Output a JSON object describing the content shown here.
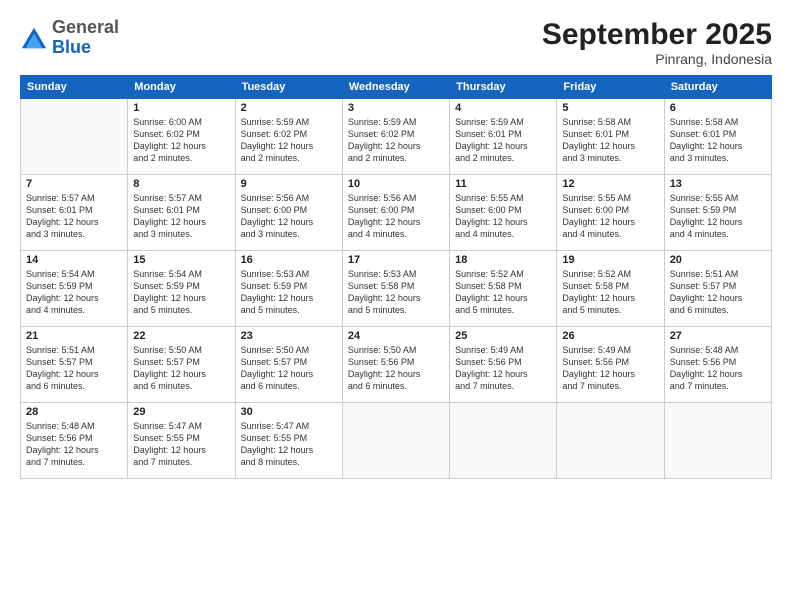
{
  "header": {
    "logo_general": "General",
    "logo_blue": "Blue",
    "month_title": "September 2025",
    "location": "Pinrang, Indonesia"
  },
  "days_of_week": [
    "Sunday",
    "Monday",
    "Tuesday",
    "Wednesday",
    "Thursday",
    "Friday",
    "Saturday"
  ],
  "weeks": [
    [
      {
        "day": "",
        "info": ""
      },
      {
        "day": "1",
        "info": "Sunrise: 6:00 AM\nSunset: 6:02 PM\nDaylight: 12 hours\nand 2 minutes."
      },
      {
        "day": "2",
        "info": "Sunrise: 5:59 AM\nSunset: 6:02 PM\nDaylight: 12 hours\nand 2 minutes."
      },
      {
        "day": "3",
        "info": "Sunrise: 5:59 AM\nSunset: 6:02 PM\nDaylight: 12 hours\nand 2 minutes."
      },
      {
        "day": "4",
        "info": "Sunrise: 5:59 AM\nSunset: 6:01 PM\nDaylight: 12 hours\nand 2 minutes."
      },
      {
        "day": "5",
        "info": "Sunrise: 5:58 AM\nSunset: 6:01 PM\nDaylight: 12 hours\nand 3 minutes."
      },
      {
        "day": "6",
        "info": "Sunrise: 5:58 AM\nSunset: 6:01 PM\nDaylight: 12 hours\nand 3 minutes."
      }
    ],
    [
      {
        "day": "7",
        "info": "Sunrise: 5:57 AM\nSunset: 6:01 PM\nDaylight: 12 hours\nand 3 minutes."
      },
      {
        "day": "8",
        "info": "Sunrise: 5:57 AM\nSunset: 6:01 PM\nDaylight: 12 hours\nand 3 minutes."
      },
      {
        "day": "9",
        "info": "Sunrise: 5:56 AM\nSunset: 6:00 PM\nDaylight: 12 hours\nand 3 minutes."
      },
      {
        "day": "10",
        "info": "Sunrise: 5:56 AM\nSunset: 6:00 PM\nDaylight: 12 hours\nand 4 minutes."
      },
      {
        "day": "11",
        "info": "Sunrise: 5:55 AM\nSunset: 6:00 PM\nDaylight: 12 hours\nand 4 minutes."
      },
      {
        "day": "12",
        "info": "Sunrise: 5:55 AM\nSunset: 6:00 PM\nDaylight: 12 hours\nand 4 minutes."
      },
      {
        "day": "13",
        "info": "Sunrise: 5:55 AM\nSunset: 5:59 PM\nDaylight: 12 hours\nand 4 minutes."
      }
    ],
    [
      {
        "day": "14",
        "info": "Sunrise: 5:54 AM\nSunset: 5:59 PM\nDaylight: 12 hours\nand 4 minutes."
      },
      {
        "day": "15",
        "info": "Sunrise: 5:54 AM\nSunset: 5:59 PM\nDaylight: 12 hours\nand 5 minutes."
      },
      {
        "day": "16",
        "info": "Sunrise: 5:53 AM\nSunset: 5:59 PM\nDaylight: 12 hours\nand 5 minutes."
      },
      {
        "day": "17",
        "info": "Sunrise: 5:53 AM\nSunset: 5:58 PM\nDaylight: 12 hours\nand 5 minutes."
      },
      {
        "day": "18",
        "info": "Sunrise: 5:52 AM\nSunset: 5:58 PM\nDaylight: 12 hours\nand 5 minutes."
      },
      {
        "day": "19",
        "info": "Sunrise: 5:52 AM\nSunset: 5:58 PM\nDaylight: 12 hours\nand 5 minutes."
      },
      {
        "day": "20",
        "info": "Sunrise: 5:51 AM\nSunset: 5:57 PM\nDaylight: 12 hours\nand 6 minutes."
      }
    ],
    [
      {
        "day": "21",
        "info": "Sunrise: 5:51 AM\nSunset: 5:57 PM\nDaylight: 12 hours\nand 6 minutes."
      },
      {
        "day": "22",
        "info": "Sunrise: 5:50 AM\nSunset: 5:57 PM\nDaylight: 12 hours\nand 6 minutes."
      },
      {
        "day": "23",
        "info": "Sunrise: 5:50 AM\nSunset: 5:57 PM\nDaylight: 12 hours\nand 6 minutes."
      },
      {
        "day": "24",
        "info": "Sunrise: 5:50 AM\nSunset: 5:56 PM\nDaylight: 12 hours\nand 6 minutes."
      },
      {
        "day": "25",
        "info": "Sunrise: 5:49 AM\nSunset: 5:56 PM\nDaylight: 12 hours\nand 7 minutes."
      },
      {
        "day": "26",
        "info": "Sunrise: 5:49 AM\nSunset: 5:56 PM\nDaylight: 12 hours\nand 7 minutes."
      },
      {
        "day": "27",
        "info": "Sunrise: 5:48 AM\nSunset: 5:56 PM\nDaylight: 12 hours\nand 7 minutes."
      }
    ],
    [
      {
        "day": "28",
        "info": "Sunrise: 5:48 AM\nSunset: 5:56 PM\nDaylight: 12 hours\nand 7 minutes."
      },
      {
        "day": "29",
        "info": "Sunrise: 5:47 AM\nSunset: 5:55 PM\nDaylight: 12 hours\nand 7 minutes."
      },
      {
        "day": "30",
        "info": "Sunrise: 5:47 AM\nSunset: 5:55 PM\nDaylight: 12 hours\nand 8 minutes."
      },
      {
        "day": "",
        "info": ""
      },
      {
        "day": "",
        "info": ""
      },
      {
        "day": "",
        "info": ""
      },
      {
        "day": "",
        "info": ""
      }
    ]
  ]
}
